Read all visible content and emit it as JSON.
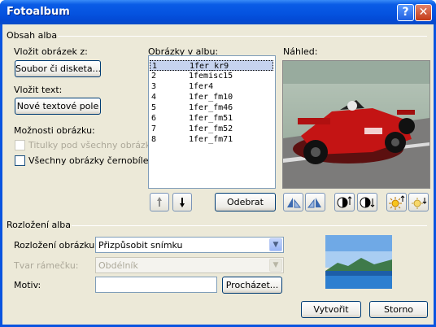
{
  "window": {
    "title": "Fotoalbum",
    "help": "?",
    "close": "✕"
  },
  "content_group": {
    "legend": "Obsah alba",
    "insert_picture_label": "Vložit obrázek z:",
    "file_button": "Soubor či disketa...",
    "insert_text_label": "Vložit text:",
    "new_textbox_button": "Nové textové pole",
    "picture_options_label": "Možnosti obrázku:",
    "captions_checkbox": "Titulky pod všechny obrázky",
    "bw_checkbox": "Všechny obrázky černobíle",
    "album_pictures_label": "Obrázky v albu:",
    "preview_label": "Náhled:",
    "items": [
      {
        "num": "1",
        "name": "1fer_kr9",
        "selected": true
      },
      {
        "num": "2",
        "name": "1femisc15",
        "selected": false
      },
      {
        "num": "3",
        "name": "1fer4",
        "selected": false
      },
      {
        "num": "4",
        "name": "1fer_fm10",
        "selected": false
      },
      {
        "num": "5",
        "name": "1fer_fm46",
        "selected": false
      },
      {
        "num": "6",
        "name": "1fer_fm51",
        "selected": false
      },
      {
        "num": "7",
        "name": "1fer_fm52",
        "selected": false
      },
      {
        "num": "8",
        "name": "1fer_fm71",
        "selected": false
      }
    ],
    "remove_button": "Odebrat",
    "move_up_icon": "arrow-up-icon",
    "move_down_icon": "arrow-down-icon"
  },
  "layout_group": {
    "legend": "Rozložení alba",
    "picture_layout_label": "Rozložení obrázku:",
    "picture_layout_value": "Přizpůsobit snímku",
    "frame_shape_label": "Tvar rámečku:",
    "frame_shape_value": "Obdélník",
    "theme_label": "Motiv:",
    "theme_value": "",
    "browse_button": "Procházet..."
  },
  "footer": {
    "create_button": "Vytvořit",
    "cancel_button": "Storno"
  }
}
